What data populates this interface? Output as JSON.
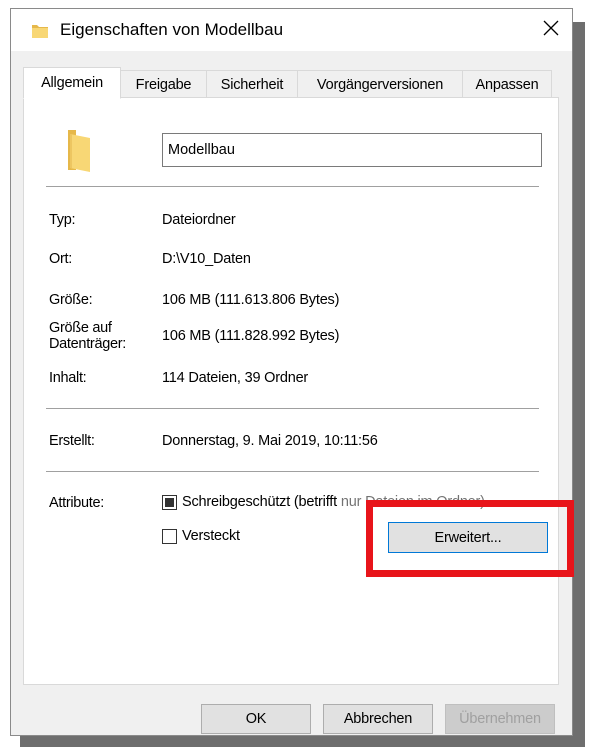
{
  "window": {
    "title": "Eigenschaften von Modellbau",
    "title_icon": "folder-icon",
    "close_glyph": "✕"
  },
  "tabs": [
    {
      "label": "Allgemein",
      "active": true
    },
    {
      "label": "Freigabe",
      "active": false
    },
    {
      "label": "Sicherheit",
      "active": false
    },
    {
      "label": "Vorgängerversionen",
      "active": false
    },
    {
      "label": "Anpassen",
      "active": false
    }
  ],
  "general": {
    "folder_name": "Modellbau",
    "properties": {
      "type_label": "Typ:",
      "type_value": "Dateiordner",
      "location_label": "Ort:",
      "location_value": "D:\\V10_Daten",
      "size_label": "Größe:",
      "size_value": "106 MB (111.613.806 Bytes)",
      "disk_size_label_1": "Größe auf",
      "disk_size_label_2": "Datenträger:",
      "disk_size_value": "106 MB (111.828.992 Bytes)",
      "contents_label": "Inhalt:",
      "contents_value": "114 Dateien, 39 Ordner"
    },
    "created_label": "Erstellt:",
    "created_value": "Donnerstag, 9. Mai 2019, 10:11:56",
    "attributes": {
      "label": "Attribute:",
      "readonly_label": "Schreibgeschützt (betrifft",
      "readonly_obscured_text": "nur Dateien im Ordner)",
      "readonly_state": "indeterminate",
      "hidden_label": "Versteckt",
      "hidden_state": "unchecked",
      "advanced_button": "Erweitert..."
    }
  },
  "footer": {
    "ok": "OK",
    "cancel": "Abbrechen",
    "apply": "Übernehmen"
  },
  "colors": {
    "folder_yellow": "#f8d775",
    "folder_dark": "#e6b84a",
    "highlight_red": "#e8141a",
    "focus_blue": "#0078d7",
    "dialog_bg": "#f0f0f0"
  }
}
